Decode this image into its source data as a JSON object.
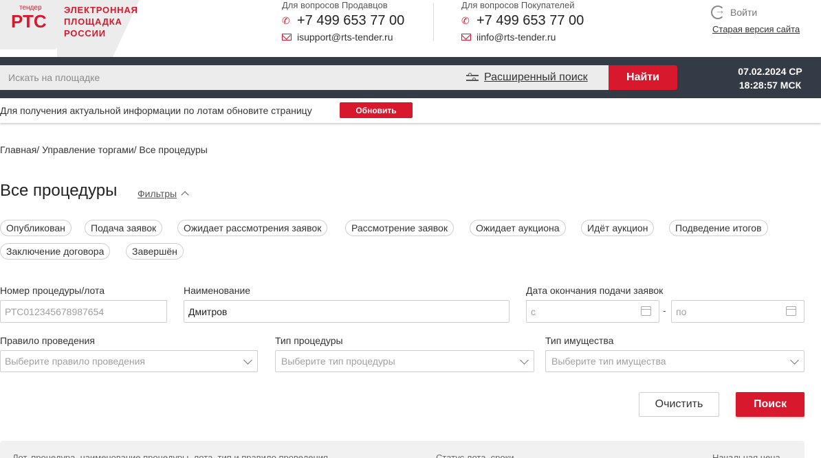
{
  "header": {
    "logo_small": "тендер",
    "logo_main": "РТС",
    "logo_text": [
      "ЭЛЕКТРОННАЯ",
      "ПЛОЩАДКА",
      "РОССИИ"
    ],
    "sellers": {
      "caption": "Для вопросов Продавцов",
      "phone": "+7 499 653 77 00",
      "email": "isupport@rts-tender.ru"
    },
    "buyers": {
      "caption": "Для вопросов Покупателей",
      "phone": "+7 499 653 77 00",
      "email": "iinfo@rts-tender.ru"
    },
    "login_label": "Войти",
    "old_version_label": "Старая версия сайта"
  },
  "search": {
    "placeholder": "Искать на площадке",
    "advanced_label": "Расширенный поиск",
    "button_label": "Найти"
  },
  "datetime": {
    "date": "07.02.2024 СР",
    "time": "18:28:57 МСК"
  },
  "notice": {
    "text": "Для получения актуальной информации по лотам обновите страницу",
    "button_label": "Обновить"
  },
  "breadcrumb": "Главная/ Управление торгами/ Все процедуры",
  "page_title": "Все процедуры",
  "filters_label": "Фильтры",
  "status_chips": [
    "Опубликован",
    "Подача заявок",
    "Ожидает рассмотрения заявок",
    "Рассмотрение заявок",
    "Ожидает аукциона",
    "Идёт аукцион",
    "Подведение итогов",
    "Заключение договора",
    "Завершён"
  ],
  "form": {
    "number": {
      "label": "Номер процедуры/лота",
      "placeholder": "РТС012345678987654"
    },
    "name": {
      "label": "Наименование",
      "value": "Дмитров"
    },
    "deadline": {
      "label": "Дата окончания подачи заявок",
      "from_placeholder": "с",
      "to_placeholder": "по",
      "separator": "-"
    },
    "rule": {
      "label": "Правило проведения",
      "placeholder": "Выберите правило проведения"
    },
    "type": {
      "label": "Тип процедуры",
      "placeholder": "Выберите тип процедуры"
    },
    "property": {
      "label": "Тип имущества",
      "placeholder": "Выберите тип имущества"
    }
  },
  "buttons": {
    "clear": "Очистить",
    "search": "Поиск"
  },
  "results_header": {
    "col1": "Лот, процедура, наименование процедуры, лота, тип и правило проведения",
    "col2": "Статус лота, сроки",
    "col3": "Начальная цена"
  },
  "colors": {
    "accent": "#d8182c",
    "dark_bar": "#343a46"
  }
}
